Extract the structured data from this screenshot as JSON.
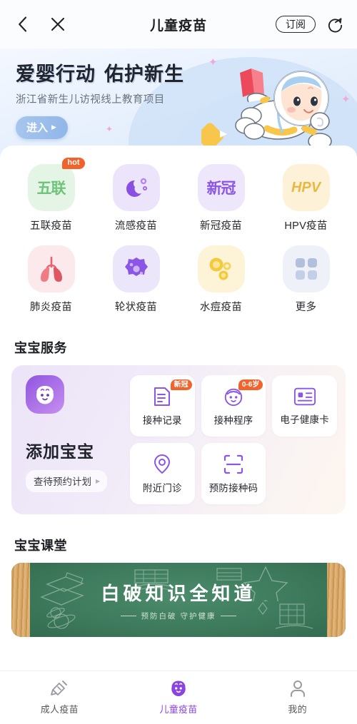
{
  "header": {
    "title": "儿童疫苗",
    "back_icon": "chevron-left-icon",
    "close_icon": "close-icon",
    "subscribe_label": "订阅",
    "share_icon": "share-refresh-icon"
  },
  "hero": {
    "title_part1": "爱婴行动",
    "title_part2": "佑护新生",
    "subtitle": "浙江省新生儿访视线上教育项目",
    "enter_label": "进入",
    "enter_arrow": "▶",
    "illustration": "astronaut-baby-illustration",
    "bg_color": "#e8f1fd",
    "button_color": "#9cc0ec"
  },
  "vaccine_grid": [
    {
      "label": "五联疫苗",
      "icon": "wulian-vaccine-icon",
      "glyph": "五联",
      "tile_bg": "#e4f4e5",
      "fg": "#6fc37a",
      "badge": "hot"
    },
    {
      "label": "流感疫苗",
      "icon": "influenza-virus-icon",
      "glyph": "",
      "tile_bg": "#ece4fb",
      "fg": "#8b4ee3",
      "badge": ""
    },
    {
      "label": "新冠疫苗",
      "icon": "covid-vaccine-icon",
      "glyph": "新冠",
      "tile_bg": "#eee7fb",
      "fg": "#8b55e6",
      "badge": ""
    },
    {
      "label": "HPV疫苗",
      "icon": "hpv-vaccine-icon",
      "glyph": "HPV",
      "tile_bg": "#fdf2d8",
      "fg": "#eab842",
      "badge": ""
    },
    {
      "label": "肺炎疫苗",
      "icon": "lungs-icon",
      "glyph": "",
      "tile_bg": "#fbe9ec",
      "fg": "#e8636f",
      "badge": ""
    },
    {
      "label": "轮状疫苗",
      "icon": "rotavirus-icon",
      "glyph": "",
      "tile_bg": "#ece6fa",
      "fg": "#8b55e6",
      "badge": ""
    },
    {
      "label": "水痘疫苗",
      "icon": "varicella-cells-icon",
      "glyph": "",
      "tile_bg": "#fdf3d6",
      "fg": "#f0c036",
      "badge": ""
    },
    {
      "label": "更多",
      "icon": "more-grid-icon",
      "glyph": "",
      "tile_bg": "#eef1f7",
      "fg": "#adbbd8",
      "badge": ""
    }
  ],
  "baby_service": {
    "section_title": "宝宝服务",
    "avatar_icon": "baby-face-icon",
    "add_baby_label": "添加宝宝",
    "plan_label": "查待预约计划",
    "plan_arrow": "▶",
    "tiles": [
      {
        "label": "接种记录",
        "icon": "document-list-icon",
        "badge": "新冠"
      },
      {
        "label": "接种程序",
        "icon": "baby-face-circle-icon",
        "badge": "0-6岁"
      },
      {
        "label": "电子健康卡",
        "icon": "id-card-icon",
        "badge": ""
      },
      {
        "label": "附近门诊",
        "icon": "location-pin-icon",
        "badge": ""
      },
      {
        "label": "预防接种码",
        "icon": "scan-code-icon",
        "badge": ""
      }
    ]
  },
  "classroom": {
    "section_title": "宝宝课堂",
    "banner_title": "白破知识全知道",
    "banner_subtitle": "预防白破 守护健康",
    "board_color": "#3f7d5f",
    "frame_color": "#d8a868"
  },
  "tabbar": [
    {
      "label": "成人疫苗",
      "icon": "syringe-icon",
      "active": false
    },
    {
      "label": "儿童疫苗",
      "icon": "baby-face-icon",
      "active": true
    },
    {
      "label": "我的",
      "icon": "person-icon",
      "active": false
    }
  ],
  "colors": {
    "accent": "#8a45e0",
    "badge_orange": "#f2622a",
    "text": "#1d1d1f"
  }
}
